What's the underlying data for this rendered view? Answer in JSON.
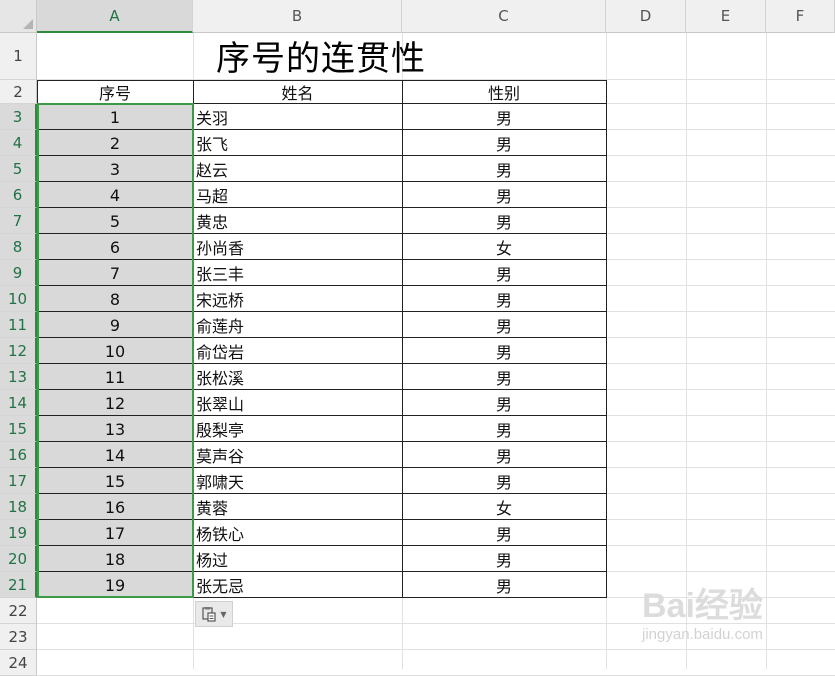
{
  "columns": [
    "A",
    "B",
    "C",
    "D",
    "E",
    "F"
  ],
  "rows": [
    "1",
    "2",
    "3",
    "4",
    "5",
    "6",
    "7",
    "8",
    "9",
    "10",
    "11",
    "12",
    "13",
    "14",
    "15",
    "16",
    "17",
    "18",
    "19",
    "20",
    "21",
    "22",
    "23",
    "24"
  ],
  "title": "序号的连贯性",
  "headers": {
    "seq": "序号",
    "name": "姓名",
    "gender": "性别"
  },
  "records": [
    {
      "seq": "1",
      "name": "关羽",
      "gender": "男"
    },
    {
      "seq": "2",
      "name": "张飞",
      "gender": "男"
    },
    {
      "seq": "3",
      "name": "赵云",
      "gender": "男"
    },
    {
      "seq": "4",
      "name": "马超",
      "gender": "男"
    },
    {
      "seq": "5",
      "name": "黄忠",
      "gender": "男"
    },
    {
      "seq": "6",
      "name": "孙尚香",
      "gender": "女"
    },
    {
      "seq": "7",
      "name": "张三丰",
      "gender": "男"
    },
    {
      "seq": "8",
      "name": "宋远桥",
      "gender": "男"
    },
    {
      "seq": "9",
      "name": "俞莲舟",
      "gender": "男"
    },
    {
      "seq": "10",
      "name": "俞岱岩",
      "gender": "男"
    },
    {
      "seq": "11",
      "name": "张松溪",
      "gender": "男"
    },
    {
      "seq": "12",
      "name": "张翠山",
      "gender": "男"
    },
    {
      "seq": "13",
      "name": "殷梨亭",
      "gender": "男"
    },
    {
      "seq": "14",
      "name": "莫声谷",
      "gender": "男"
    },
    {
      "seq": "15",
      "name": "郭啸天",
      "gender": "男"
    },
    {
      "seq": "16",
      "name": "黄蓉",
      "gender": "女"
    },
    {
      "seq": "17",
      "name": "杨铁心",
      "gender": "男"
    },
    {
      "seq": "18",
      "name": "杨过",
      "gender": "男"
    },
    {
      "seq": "19",
      "name": "张无忌",
      "gender": "男"
    }
  ],
  "selection": {
    "column": "A",
    "first_row": "3",
    "last_row": "21"
  },
  "colors": {
    "selection_accent": "#3c9a46",
    "header_bg": "#f0f0f0",
    "selected_header_bg": "#d9d9d9"
  },
  "paste_options_icon": "paste-options-icon",
  "watermark": {
    "main": "Bai经验",
    "sub": "jingyan.baidu.com"
  }
}
